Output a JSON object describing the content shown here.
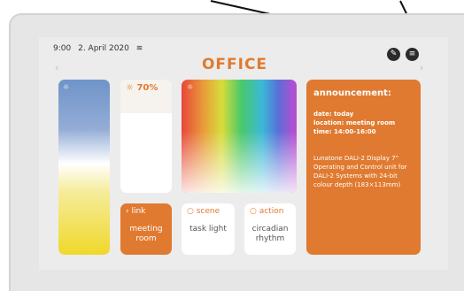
{
  "status": {
    "time": "9:00",
    "date": "2. April 2020",
    "wifi_icon": "wifi-icon"
  },
  "title": "OFFICE",
  "dimmer": {
    "value_label": "70%"
  },
  "tiles": {
    "link": {
      "head": "link",
      "label": "meeting room"
    },
    "scene": {
      "head": "scene",
      "label": "task light"
    },
    "action": {
      "head": "action",
      "label": "circadian rhythm"
    }
  },
  "announcement": {
    "heading": "announcement:",
    "date": "date: today",
    "location": "location: meeting room",
    "time": "time: 14:00-16:00",
    "body": "Lunatone DALI-2 Display 7\" Operating and Control unit for DALI-2 Systems with 24-bit colour depth (183×113mm)"
  },
  "colors": {
    "accent": "#e07a30",
    "screen": "#ececec",
    "bezel": "#e6e6e6"
  }
}
